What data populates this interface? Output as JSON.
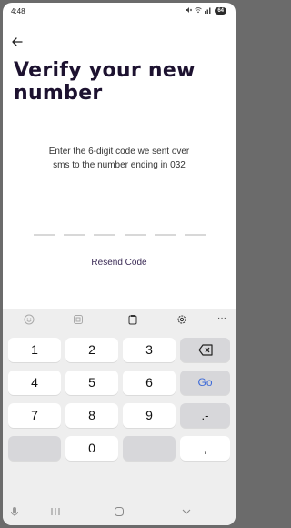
{
  "status_bar": {
    "time": "4:48",
    "battery": "64"
  },
  "screen": {
    "title": "Verify your new number",
    "subtitle_line1": "Enter the 6-digit code we sent over",
    "subtitle_line2": "sms to the number ending in 032",
    "code_length": 6,
    "resend_label": "Resend Code"
  },
  "keyboard": {
    "toolbar_icons": [
      "emoji-icon",
      "sticker-icon",
      "clipboard-icon",
      "settings-icon",
      "more-icon"
    ],
    "more_label": "···",
    "rows": [
      [
        "1",
        "2",
        "3",
        "⌫"
      ],
      [
        "4",
        "5",
        "6",
        "Go"
      ],
      [
        "7",
        "8",
        "9",
        ".-"
      ],
      [
        "",
        "0",
        "",
        ","
      ]
    ]
  },
  "colors": {
    "title": "#1d1230",
    "go_key": "#3e6bd8",
    "keyboard_bg": "#eeeeee"
  }
}
